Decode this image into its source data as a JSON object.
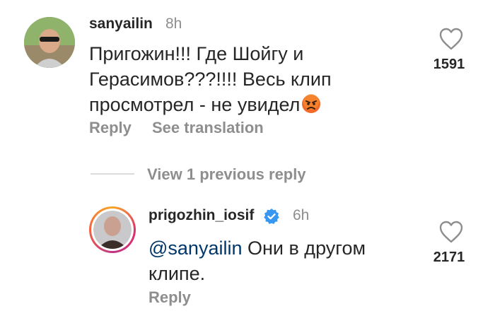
{
  "comment": {
    "username": "sanyailin",
    "time": "8h",
    "lines": [
      "Пригожин!!! Где Шойгу и",
      "Герасимов???!!!! Весь клип",
      "просмотрел - не увидел"
    ],
    "emoji_icon": "angry-face-icon",
    "likes": "1591",
    "reply_label": "Reply",
    "translation_label": "See translation"
  },
  "thread": {
    "view_replies_label": "View 1 previous reply"
  },
  "reply": {
    "username": "prigozhin_iosif",
    "verified_icon": "verified-badge-icon",
    "time": "6h",
    "mention": "@sanyailin",
    "text_line1": " Они в другом",
    "text_line2": "клипе.",
    "likes": "2171",
    "reply_label": "Reply"
  },
  "colors": {
    "verified": "#3897f0",
    "mention": "#00376b",
    "story_ring_start": "#f9a825",
    "story_ring_end": "#c13584"
  }
}
